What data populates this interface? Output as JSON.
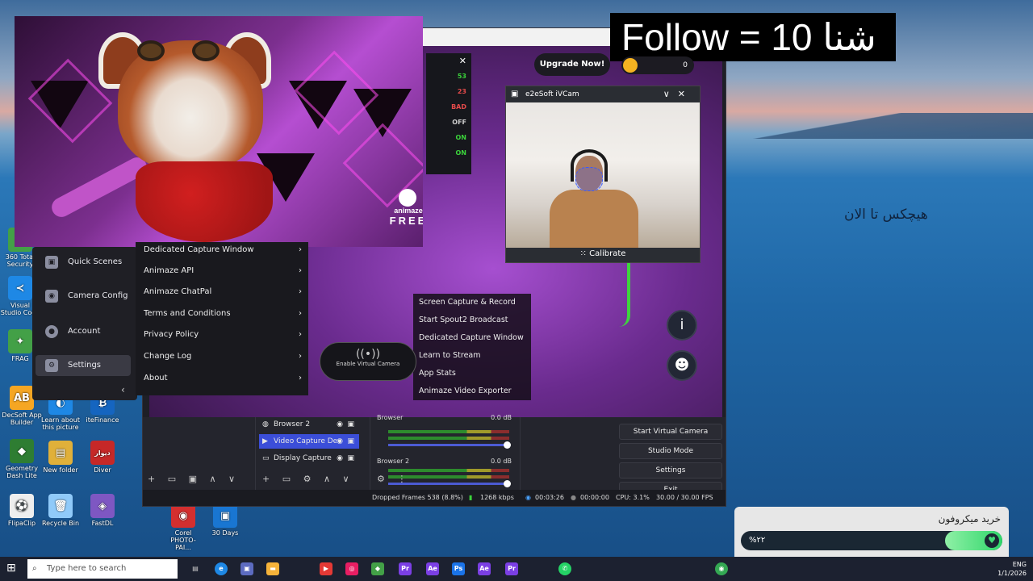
{
  "banner": {
    "text": "Follow = 10 شنا"
  },
  "desktop": {
    "right_text": "هیچکس تا الان",
    "icons": [
      {
        "label": "DecSoft App Builder",
        "glyph": "AB",
        "color": "#f5a623"
      },
      {
        "label": "Learn about this picture",
        "glyph": "◐",
        "color": "#1e88e5"
      },
      {
        "label": "iteFinance",
        "glyph": "₿",
        "color": "#1565c0"
      },
      {
        "label": "Geometry Dash Lite",
        "glyph": "◆",
        "color": "#2e7d32"
      },
      {
        "label": "New folder",
        "glyph": "▤",
        "color": "#e0b03a"
      },
      {
        "label": "Diver",
        "glyph": "دیوار",
        "color": "#c62828"
      },
      {
        "label": "FlipaClip",
        "glyph": "⚽",
        "color": "#eeeeee"
      },
      {
        "label": "Recycle Bin",
        "glyph": "🗑",
        "color": "#90caf9"
      },
      {
        "label": "FastDL",
        "glyph": "◈",
        "color": "#7e57c2"
      },
      {
        "label": "Corel PHOTO-PAI...",
        "glyph": "◉",
        "color": "#d32f2f"
      },
      {
        "label": "30 Days",
        "glyph": "▣",
        "color": "#1976d2"
      },
      {
        "label": "FRAG",
        "glyph": "✦",
        "color": "#43a047"
      },
      {
        "label": "Visual Studio Code",
        "glyph": "≺",
        "color": "#1e88e5"
      },
      {
        "label": "360 Total Security",
        "glyph": "◍",
        "color": "#43a047"
      }
    ]
  },
  "animaze": {
    "logo": {
      "name": "animaze",
      "edition": "FREE"
    },
    "sidebar": [
      {
        "label": "Quick Scenes",
        "icon": "▣"
      },
      {
        "label": "Camera Config",
        "icon": "◉"
      },
      {
        "label": "Account",
        "icon": "●"
      },
      {
        "label": "Settings",
        "icon": "⚙"
      }
    ],
    "submenu": [
      "Dedicated Capture Window",
      "Animaze API",
      "Animaze ChatPal",
      "Terms and Conditions",
      "Privacy Policy",
      "Change Log",
      "About"
    ],
    "dropdown": [
      "Screen Capture & Record",
      "Start Spout2 Broadcast",
      "Dedicated Capture Window",
      "Learn to Stream",
      "App Stats",
      "Animaze Video Exporter"
    ],
    "virtual_camera": "Enable Virtual Camera",
    "upgrade": "Upgrade Now!",
    "coins": "0"
  },
  "obs": {
    "stats": [
      "53",
      "23",
      "BAD",
      "OFF",
      "ON",
      "ON"
    ],
    "stat_colors": [
      "#3bd33b",
      "#e34a4a",
      "#e34a4a",
      "#cfcfcf",
      "#3bd33b",
      "#3bd33b"
    ],
    "sources": [
      {
        "name": "Browser 2",
        "icon": "◍"
      },
      {
        "name": "Video Capture Dev",
        "icon": "▶"
      },
      {
        "name": "Display Capture",
        "icon": "▭"
      }
    ],
    "mixer": [
      {
        "name": "Browser",
        "db": "0.0 dB"
      },
      {
        "name": "Browser 2",
        "db": "0.0 dB"
      }
    ],
    "controls": [
      "Start Virtual Camera",
      "Studio Mode",
      "Settings",
      "Exit"
    ],
    "status": {
      "dropped": "Dropped Frames 538 (8.8%)",
      "bitrate": "1268 kbps",
      "stream_time": "00:03:26",
      "rec_time": "00:00:00",
      "cpu": "CPU: 3.1%",
      "fps": "30.00 / 30.00 FPS"
    }
  },
  "ivcam": {
    "title": "e2eSoft iVCam",
    "calibrate": "Calibrate"
  },
  "donation": {
    "title": "خرید میکروفون",
    "percent": "%۲۲",
    "progress": 0.22
  },
  "taskbar": {
    "search_placeholder": "Type here to search",
    "lang": "ENG",
    "date": "1/1/2026",
    "apps": [
      {
        "glyph": "Ps",
        "color": "#1a73e8"
      },
      {
        "glyph": "Ae",
        "color": "#7b3fe4"
      },
      {
        "glyph": "Pr",
        "color": "#7b3fe4"
      },
      {
        "glyph": "▶",
        "color": "#e53935"
      },
      {
        "glyph": "◎",
        "color": "#e91e63"
      },
      {
        "glyph": "◆",
        "color": "#43a047"
      },
      {
        "glyph": "Pr",
        "color": "#7b3fe4"
      },
      {
        "glyph": "Ae",
        "color": "#7b3fe4"
      }
    ]
  }
}
